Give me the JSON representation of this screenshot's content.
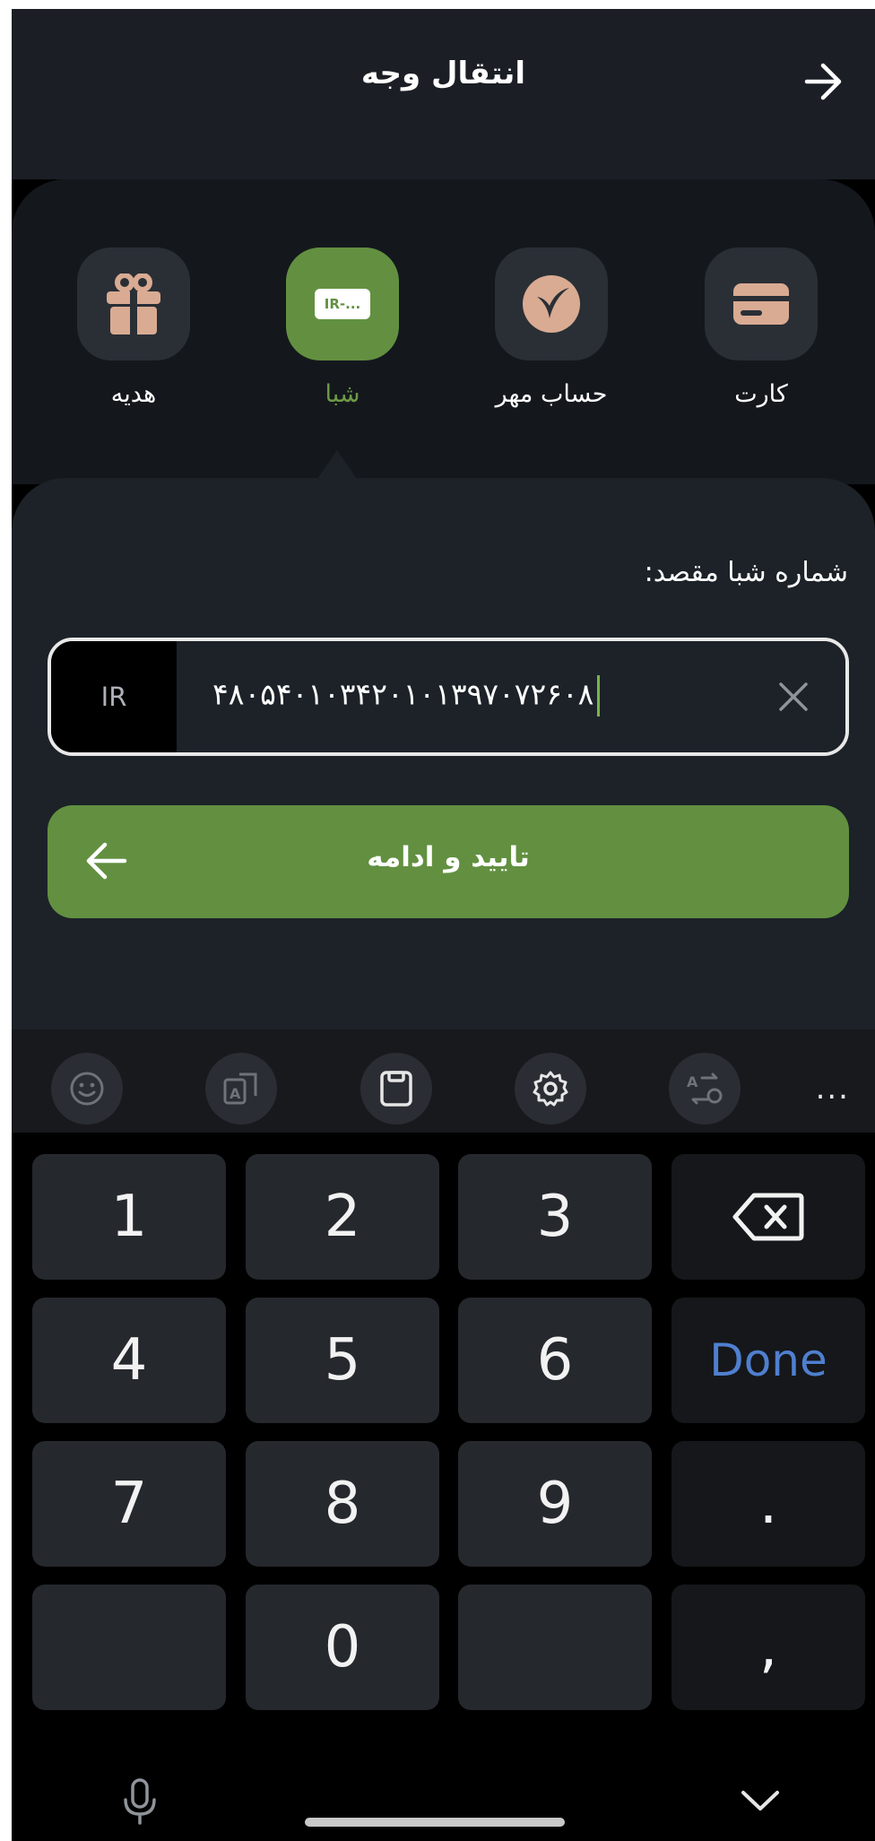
{
  "header": {
    "title": "انتقال وجه"
  },
  "methods": [
    {
      "label": "کارت",
      "icon": "card-icon",
      "active": false
    },
    {
      "label": "حساب مهر",
      "icon": "mehr-account-icon",
      "active": false
    },
    {
      "label": "شبا",
      "icon": "iban-icon",
      "badge": "IR-...",
      "active": true
    },
    {
      "label": "هدیه",
      "icon": "gift-icon",
      "active": false
    }
  ],
  "form": {
    "label": "شماره شبا مقصد:",
    "prefix": "IR",
    "value": "۴۸۰۵۴۰۱۰۳۴۲۰۱۰۱۳۹۷۰۷۲۶۰۸",
    "submit_label": "تایید و ادامه"
  },
  "toolbar": {
    "icons": [
      "emoji-icon",
      "translate-icon",
      "clipboard-icon",
      "settings-icon",
      "convert-icon"
    ],
    "more": "..."
  },
  "keypad": {
    "rows": [
      [
        "1",
        "2",
        "3",
        "backspace"
      ],
      [
        "4",
        "5",
        "6",
        "Done"
      ],
      [
        "7",
        "8",
        "9",
        "."
      ],
      [
        "",
        "0",
        "",
        ","
      ]
    ]
  },
  "colors": {
    "accent": "#629040",
    "header_bg": "#1b1f25",
    "panel_bg": "#1c2228",
    "done": "#4f7fcf"
  }
}
